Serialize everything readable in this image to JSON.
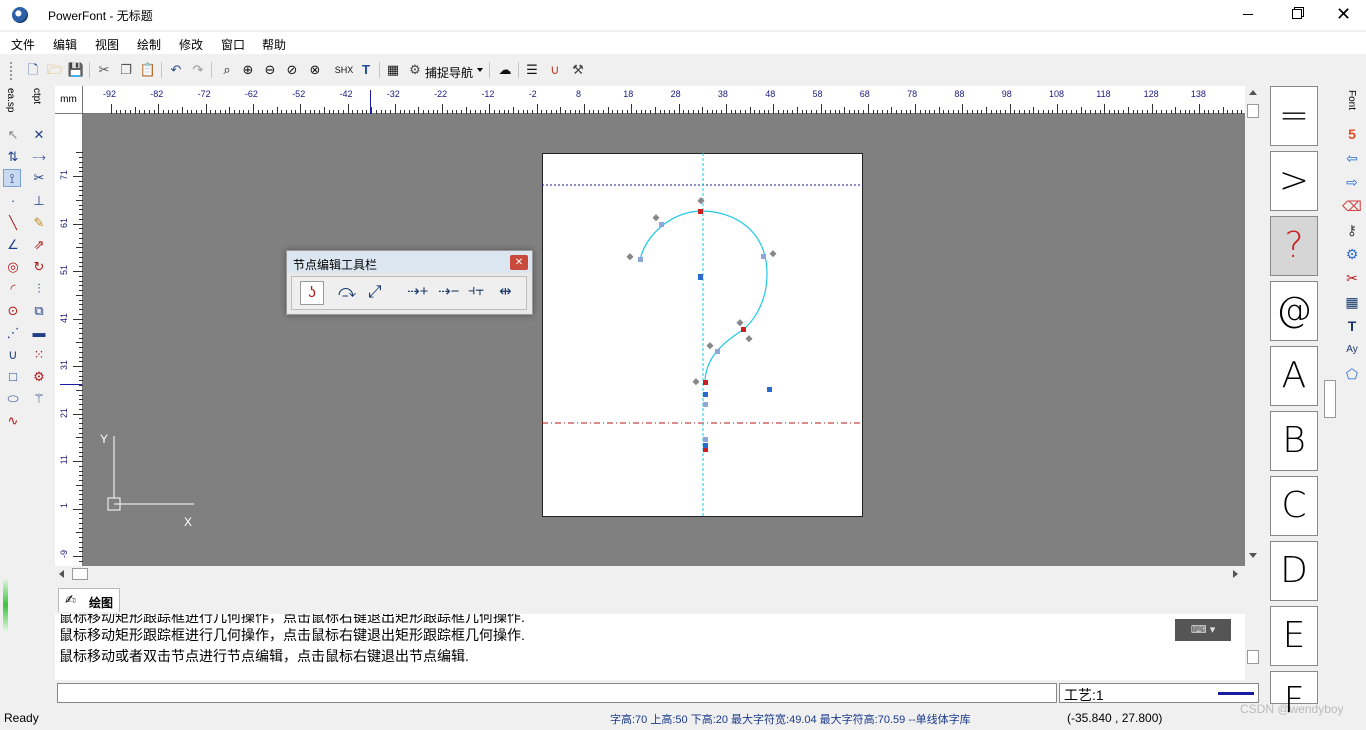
{
  "window": {
    "title": "PowerFont - 无标题",
    "controls": [
      "minimize-icon",
      "maximize-icon",
      "close-icon"
    ]
  },
  "menu": [
    "文件",
    "编辑",
    "视图",
    "绘制",
    "修改",
    "窗口",
    "帮助"
  ],
  "toolbar": {
    "shx_label": "SHX",
    "snap_label": "捕捉导航"
  },
  "left_panel": {
    "tab1": "ea.sp",
    "tab2": "ctpt"
  },
  "ruler": {
    "unit": "mm",
    "top_ticks": [
      "-92",
      "-82",
      "-72",
      "-62",
      "-52",
      "-42",
      "-32",
      "-22",
      "-12",
      "-2",
      "8",
      "18",
      "28",
      "38",
      "48",
      "58",
      "68",
      "78",
      "88",
      "98",
      "108",
      "118",
      "128",
      "138"
    ],
    "left_ticks": [
      "71",
      "61",
      "51",
      "41",
      "31",
      "21",
      "11",
      "1",
      "-9"
    ]
  },
  "axis": {
    "y": "Y",
    "x": "X"
  },
  "node_toolbar": {
    "title": "节点编辑工具栏"
  },
  "tabs": {
    "draw": "绘图"
  },
  "log": {
    "lines": [
      "鼠标移动矩形跟踪框进行几何操作，点击鼠标右键退出矩形跟踪框几何操作.",
      "鼠标移动矩形跟踪框进行几何操作，点击鼠标右键退出矩形跟踪框几何操作.",
      "鼠标移动或者双击节点进行节点编辑，点击鼠标右键退出节点编辑."
    ]
  },
  "command": {
    "value": "",
    "gongyi": "工艺:1"
  },
  "status": {
    "ready": "Ready",
    "metrics": "字高:70 上高:50 下高:20 最大字符宽:49.04  最大字符高:70.59  --单线体字库",
    "coords": "(-35.840 , 27.800)",
    "watermark": "CSDN @wendyboy"
  },
  "glyphs": [
    "=",
    ">",
    "?",
    "@",
    "A",
    "B",
    "C",
    "D",
    "E",
    "F"
  ],
  "right_panel": {
    "tab": "Font"
  },
  "colors": {
    "canvas": "#808080",
    "curve": "#1ec8e6",
    "guide_blue": "#1a1aa0",
    "baseline_red": "#b01818",
    "node_red": "#cc2020",
    "node_blue": "#2a6ad0"
  }
}
